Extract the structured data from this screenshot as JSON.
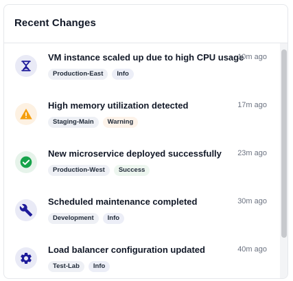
{
  "panel": {
    "title": "Recent Changes"
  },
  "colors": {
    "info_icon": "#1e1b9a",
    "warning_icon": "#f59e0b",
    "success_icon": "#16a34a"
  },
  "items": [
    {
      "title": "VM instance scaled up due to high CPU usage",
      "time": "10m ago",
      "icon": "scale-hourglass-icon",
      "tags": [
        "Production-East",
        "Info"
      ]
    },
    {
      "title": "High memory utilization detected",
      "time": "17m ago",
      "icon": "warning-triangle-icon",
      "tags": [
        "Staging-Main",
        "Warning"
      ]
    },
    {
      "title": "New microservice deployed successfully",
      "time": "23m ago",
      "icon": "check-circle-icon",
      "tags": [
        "Production-West",
        "Success"
      ]
    },
    {
      "title": "Scheduled maintenance completed",
      "time": "30m ago",
      "icon": "wrench-icon",
      "tags": [
        "Development",
        "Info"
      ]
    },
    {
      "title": "Load balancer configuration updated",
      "time": "40m ago",
      "icon": "gear-icon",
      "tags": [
        "Test-Lab",
        "Info"
      ]
    }
  ]
}
